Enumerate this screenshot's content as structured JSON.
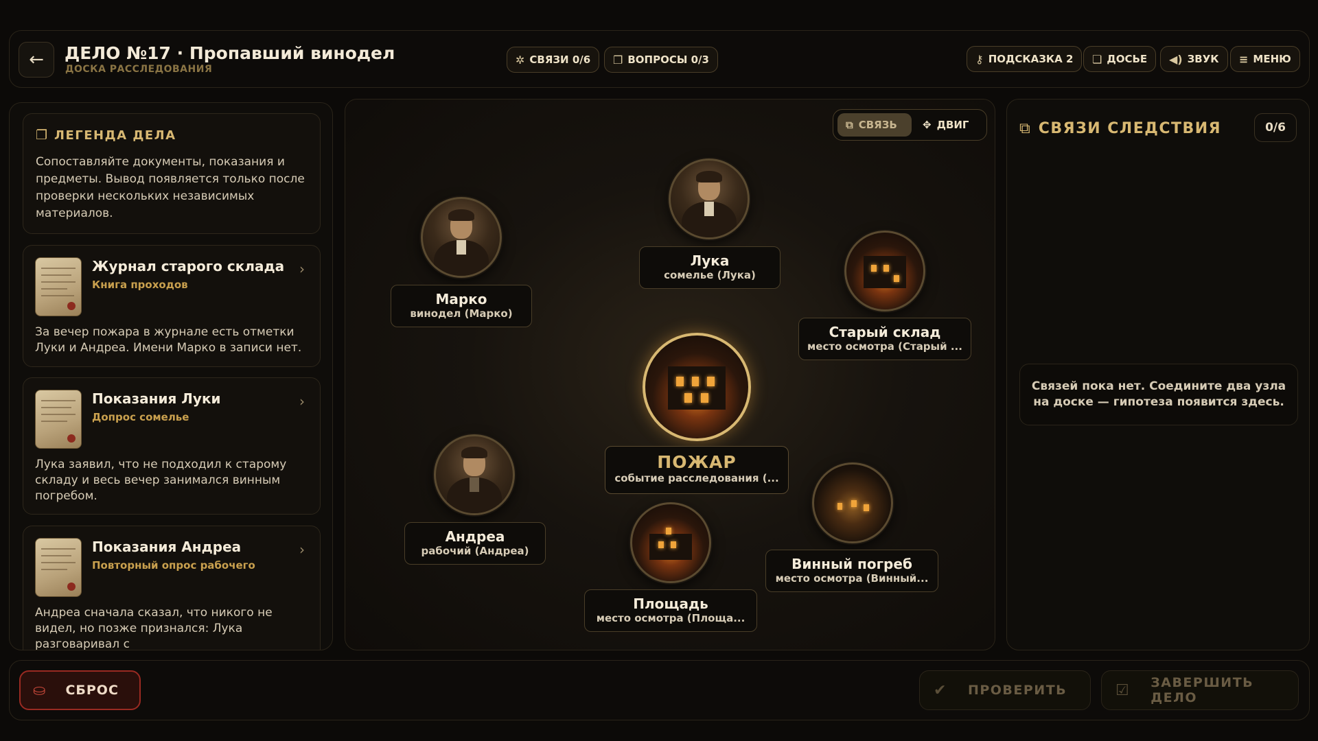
{
  "header": {
    "title": "ДЕЛО №17 · Пропавший винодел",
    "subtitle": "ДОСКА РАССЛЕДОВАНИЯ",
    "stats": [
      {
        "label": "СВЯЗИ 0/6",
        "icon": "network-icon"
      },
      {
        "label": "ВОПРОСЫ 0/3",
        "icon": "questions-icon"
      }
    ],
    "actions": [
      {
        "label": "ПОДСКАЗКА 2",
        "icon": "key-icon"
      },
      {
        "label": "ДОСЬЕ",
        "icon": "folder-icon"
      },
      {
        "label": "ЗВУК",
        "icon": "speaker-icon"
      },
      {
        "label": "МЕНЮ",
        "icon": "menu-icon"
      }
    ]
  },
  "left": {
    "legend_title": "ЛЕГЕНДА ДЕЛА",
    "legend_text": "Сопоставляйте документы, показания и предметы. Вывод появляется только после проверки нескольких независимых материалов.",
    "documents": [
      {
        "title": "Журнал старого склада",
        "subtitle": "Книга проходов",
        "body": "За вечер пожара в журнале есть отметки Луки и Андреа. Имени Марко в записи нет."
      },
      {
        "title": "Показания Луки",
        "subtitle": "Допрос сомелье",
        "body": "Лука заявил, что не подходил к старому складу и весь вечер занимался винным погребом."
      },
      {
        "title": "Показания Андреа",
        "subtitle": "Повторный опрос рабочего",
        "body": "Андреа сначала сказал, что никого не видел, но позже признался: Лука разговаривал с"
      }
    ]
  },
  "board": {
    "mode_link": "СВЯЗЬ",
    "mode_move": "ДВИГ",
    "nodes": [
      {
        "name": "Марко",
        "role": "винодел (Марко)",
        "kind": "person"
      },
      {
        "name": "Лука",
        "role": "сомелье (Лука)",
        "kind": "person"
      },
      {
        "name": "Старый склад",
        "role": "место осмотра (Старый ...",
        "kind": "place"
      },
      {
        "name": "ПОЖАР",
        "role": "событие расследования (...",
        "kind": "event"
      },
      {
        "name": "Андреа",
        "role": "рабочий (Андреа)",
        "kind": "person"
      },
      {
        "name": "Винный погреб",
        "role": "место осмотра (Винный...",
        "kind": "place"
      },
      {
        "name": "Площадь",
        "role": "место осмотра (Площа...",
        "kind": "place"
      }
    ]
  },
  "right": {
    "title": "СВЯЗИ СЛЕДСТВИЯ",
    "count": "0/6",
    "empty_text": "Связей пока нет. Соедините два узла на доске — гипотеза появится здесь."
  },
  "footer": {
    "reset": "СБРОС",
    "check": "ПРОВЕРИТЬ",
    "finish": "ЗАВЕРШИТЬ ДЕЛО"
  },
  "colors": {
    "accent_gold": "#d8b872",
    "danger_red": "#9a2a22",
    "background": "#0c0a08"
  }
}
